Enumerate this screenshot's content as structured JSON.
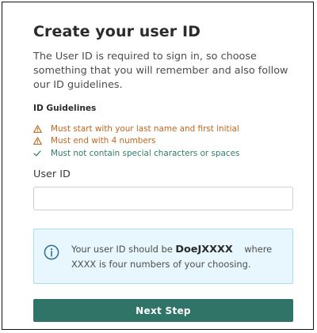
{
  "page": {
    "title": "Create your user ID",
    "intro": "The User ID is required to sign in, so choose something that you will remember and also follow our ID guidelines."
  },
  "guidelines": {
    "heading": "ID Guidelines",
    "items": [
      {
        "text": "Must start with your last name and first initial",
        "status": "warning",
        "icon": "warning-icon"
      },
      {
        "text": "Must end with 4 numbers",
        "status": "warning",
        "icon": "warning-icon"
      },
      {
        "text": "Must not contain special characters or spaces",
        "status": "met",
        "icon": "check-icon"
      }
    ]
  },
  "field": {
    "label": "User ID",
    "value": "",
    "placeholder": ""
  },
  "info": {
    "icon": "info-icon",
    "text_before": "Your user ID should be",
    "example_id": "DoeJXXXX",
    "text_after": "where XXXX is four numbers of your choosing."
  },
  "button": {
    "label": "Next Step"
  },
  "colors": {
    "accent": "#2f7467",
    "warning": "#c0671f",
    "success": "#2e7d6b",
    "info_background": "#e7f7fd",
    "info_border": "#a9dcee",
    "info_icon": "#2b6f96"
  }
}
